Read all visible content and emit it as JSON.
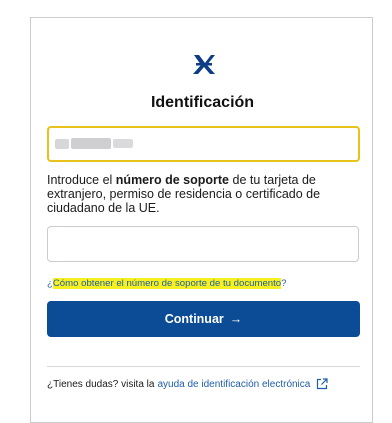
{
  "page": {
    "title": "Identificación"
  },
  "id_field": {
    "value": ""
  },
  "instructions": {
    "prefix": "Introduce el ",
    "bold": "número de soporte",
    "suffix": " de tu tarjeta de extranjero, permiso de residencia o certificado de ciudadano de la UE."
  },
  "support_field": {
    "value": ""
  },
  "help": {
    "open": "¿",
    "link": "Cómo obtener el número de soporte de tu documento",
    "close": "?"
  },
  "continue_button": {
    "label": "Continuar",
    "arrow": "→"
  },
  "footer": {
    "text": "¿Tienes dudas? visita la",
    "link": "ayuda de identificación electrónica"
  },
  "colors": {
    "primary": "#0c4c96",
    "highlight": "#f7f020",
    "focus_border": "#e6c21a",
    "link": "#1f5ea8"
  }
}
